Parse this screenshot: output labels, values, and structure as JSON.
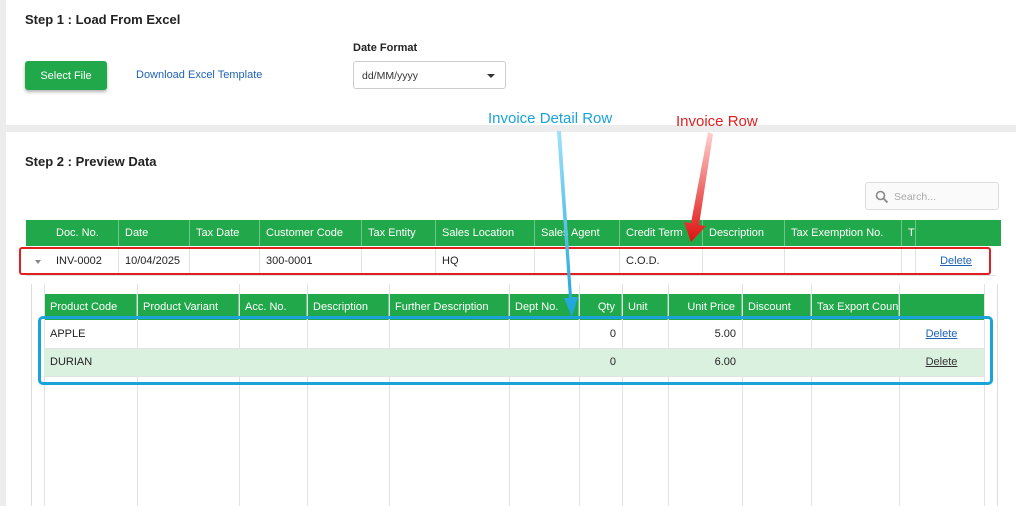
{
  "step1": {
    "title": "Step 1 : Load From Excel",
    "select_file": "Select File",
    "download_template": "Download Excel Template",
    "date_format_label": "Date Format",
    "date_format_value": "dd/MM/yyyy"
  },
  "step2": {
    "title": "Step 2 : Preview Data",
    "search_placeholder": "Search..."
  },
  "invoice_headers": [
    "Doc. No.",
    "Date",
    "Tax Date",
    "Customer Code",
    "Tax Entity",
    "Sales Location",
    "Sales Agent",
    "Credit Term",
    "Description",
    "Tax Exemption No.",
    "T"
  ],
  "invoice_row": {
    "doc_no": "INV-0002",
    "date": "10/04/2025",
    "tax_date": "",
    "customer_code": "300-0001",
    "tax_entity": "",
    "sales_location": "HQ",
    "sales_agent": "",
    "credit_term": "C.O.D.",
    "description": "",
    "tax_exemption_no": "",
    "delete": "Delete"
  },
  "detail_headers": [
    "Product Code",
    "Product Variant",
    "Acc. No.",
    "Description",
    "Further Description",
    "Dept No.",
    "Qty",
    "Unit",
    "Unit Price",
    "Discount",
    "Tax Export Coun"
  ],
  "detail_rows": [
    {
      "product_code": "APPLE",
      "qty": "0",
      "unit_price": "5.00",
      "delete": "Delete"
    },
    {
      "product_code": "DURIAN",
      "qty": "0",
      "unit_price": "6.00",
      "delete": "Delete"
    }
  ],
  "annotations": {
    "detail_label": "Invoice Detail Row",
    "invoice_label": "Invoice Row",
    "red": "#e02020",
    "blue": "#1aa3d9"
  },
  "colors": {
    "accent_green": "#21a84a",
    "row_highlight": "#dbf1df",
    "link_blue": "#1f62b5"
  }
}
